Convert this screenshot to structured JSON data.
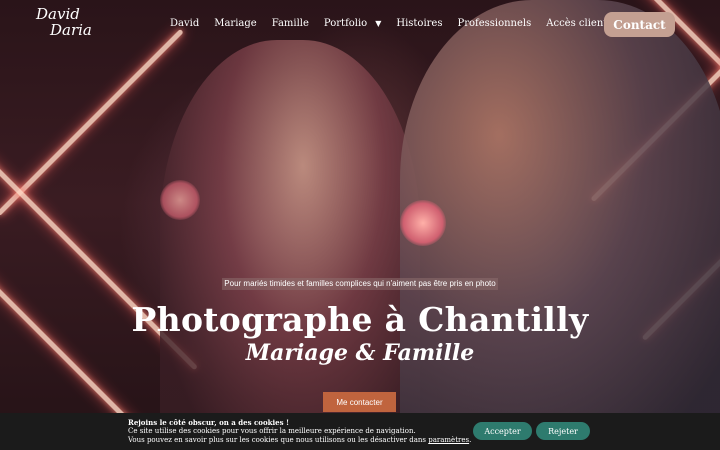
{
  "logo": {
    "line1": "David",
    "line2": "Daria"
  },
  "nav": {
    "items": [
      {
        "label": "David"
      },
      {
        "label": "Mariage"
      },
      {
        "label": "Famille"
      },
      {
        "label": "Portfolio"
      },
      {
        "label": "Histoires"
      },
      {
        "label": "Professionnels"
      },
      {
        "label": "Accès clients"
      }
    ],
    "portfolio_chevron": "chevron-down-icon",
    "contact_label": "Contact"
  },
  "hero": {
    "tagline": "Pour mariés timides et familles complices qui n'aiment pas être pris en photo",
    "title": "Photographe à Chantilly",
    "subtitle": "Mariage & Famille",
    "cta_label": "Me contacter"
  },
  "cookie": {
    "title": "Rejoins le côté obscur, on a des cookies !",
    "line1": "Ce site utilise des cookies pour vous offrir la meilleure expérience de navigation.",
    "line2_prefix": "Vous pouvez en savoir plus sur les cookies que nous utilisons ou les désactiver dans ",
    "line2_link": "paramètres",
    "line2_suffix": ".",
    "accept_label": "Accepter",
    "reject_label": "Rejeter"
  },
  "colors": {
    "contact_button": "#c4a092",
    "cta_button": "#c0643e",
    "cookie_buttons": "#2e7b6e",
    "cookie_bar": "#1b1b1b"
  }
}
